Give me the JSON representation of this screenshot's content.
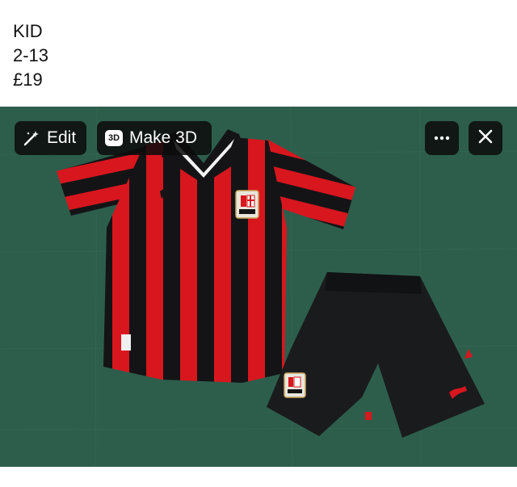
{
  "post": {
    "line1": "KID",
    "line2": "2-13",
    "line3": "£19"
  },
  "toolbar": {
    "edit_label": "Edit",
    "make3d_badge": "3D",
    "make3d_label": "Make 3D",
    "more_icon": "ellipsis-icon",
    "close_icon": "close-icon",
    "edit_icon": "magic-wand-icon"
  },
  "colors": {
    "background_green": "#2f6350",
    "stripe_red": "#d8161e",
    "stripe_black": "#141416",
    "pill_bg": "#0c0c0c"
  }
}
